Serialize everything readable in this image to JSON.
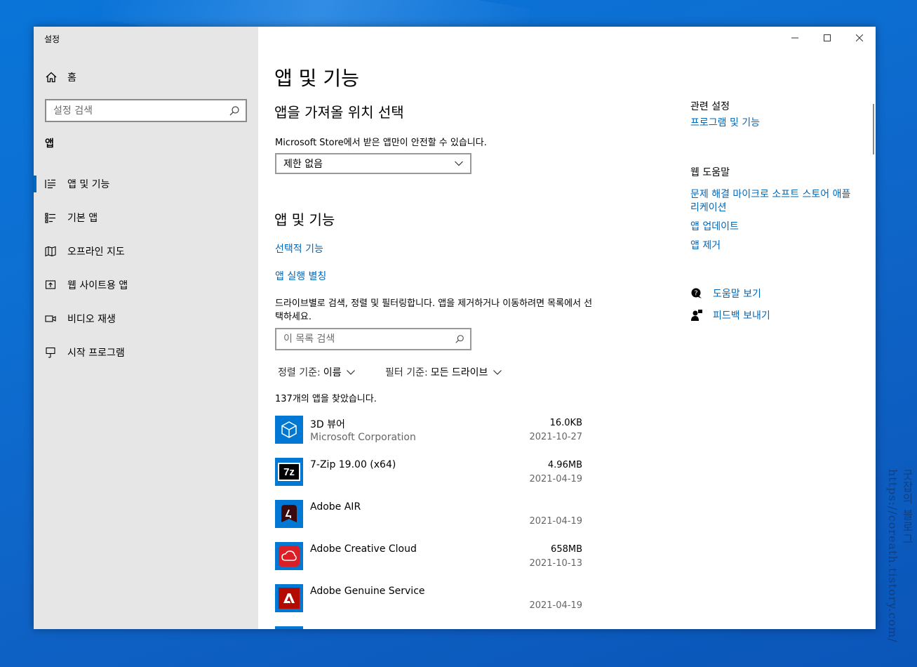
{
  "window": {
    "title": "설정"
  },
  "sidebar": {
    "home_label": "홈",
    "search_placeholder": "설정 검색",
    "section_label": "앱",
    "items": [
      {
        "label": "앱 및 기능",
        "icon": "apps-features-icon",
        "active": true
      },
      {
        "label": "기본 앱",
        "icon": "default-apps-icon"
      },
      {
        "label": "오프라인 지도",
        "icon": "map-icon"
      },
      {
        "label": "웹 사이트용 앱",
        "icon": "web-app-icon"
      },
      {
        "label": "비디오 재생",
        "icon": "video-icon"
      },
      {
        "label": "시작 프로그램",
        "icon": "startup-icon"
      }
    ]
  },
  "main": {
    "page_title": "앱 및 기능",
    "install_section": {
      "heading": "앱을 가져올 위치 선택",
      "description": "Microsoft Store에서 받은 앱만이 안전할 수 있습니다.",
      "dropdown_value": "제한 없음"
    },
    "apps_section": {
      "heading": "앱 및 기능",
      "optional_features_link": "선택적 기능",
      "app_aliases_link": "앱 실행 별칭",
      "description": "드라이브별로 검색, 정렬 및 필터링합니다. 앱을 제거하거나 이동하려면 목록에서 선택하세요.",
      "search_placeholder": "이 목록 검색",
      "sort_label": "정렬 기준:",
      "sort_value": "이름",
      "filter_label": "필터 기준:",
      "filter_value": "모든 드라이브",
      "count_text": "137개의 앱을 찾았습니다."
    },
    "apps": [
      {
        "name": "3D 뷰어",
        "publisher": "Microsoft Corporation",
        "size": "16.0KB",
        "date": "2021-10-27",
        "icon": "3d-viewer-icon"
      },
      {
        "name": "7-Zip 19.00 (x64)",
        "publisher": "",
        "size": "4.96MB",
        "date": "2021-04-19",
        "icon": "7zip-icon"
      },
      {
        "name": "Adobe AIR",
        "publisher": "",
        "size": "",
        "date": "2021-04-19",
        "icon": "adobe-air-icon"
      },
      {
        "name": "Adobe Creative Cloud",
        "publisher": "",
        "size": "658MB",
        "date": "2021-10-13",
        "icon": "creative-cloud-icon"
      },
      {
        "name": "Adobe Genuine Service",
        "publisher": "",
        "size": "",
        "date": "2021-04-19",
        "icon": "adobe-genuine-icon"
      }
    ]
  },
  "right": {
    "related_heading": "관련 설정",
    "programs_link": "프로그램 및 기능",
    "web_help_heading": "웹 도움말",
    "help_links": [
      "문제 해결 마이크로 소프트 스토어 애플 리케이션",
      "앱 업데이트",
      "앱 제거"
    ],
    "get_help": "도움말 보기",
    "feedback": "피드백 보내기"
  },
  "watermark": "굿잡의 블로그 https://coreath.tistory.com/",
  "colors": {
    "accent": "#0067b8",
    "sidebar_bg": "#e6e6e6",
    "tile_blue": "#0078d4",
    "desktop": "#0a6cd4"
  }
}
